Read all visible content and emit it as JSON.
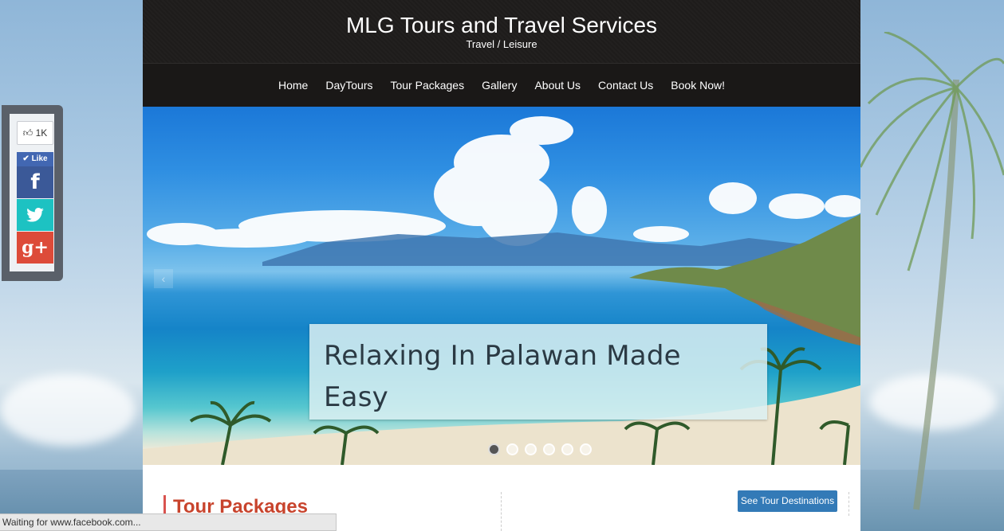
{
  "header": {
    "title": "MLG Tours and Travel Services",
    "tagline": "Travel / Leisure"
  },
  "nav": {
    "items": [
      "Home",
      "DayTours",
      "Tour Packages",
      "Gallery",
      "About Us",
      "Contact Us",
      "Book Now!"
    ]
  },
  "slider": {
    "caption": "Relaxing In Palawan Made Easy",
    "prev_icon": "chevron-left-icon",
    "slide_count": 6,
    "active_slide": 1
  },
  "content": {
    "section_title": "Tour Packages",
    "destinations_button": "See Tour Destinations"
  },
  "social": {
    "like_count": "1K",
    "like_label": "Like",
    "facebook_glyph": "f",
    "googleplus_glyph": "g+",
    "colors": {
      "facebook": "#3b5998",
      "twitter": "#1dc2c2",
      "googleplus": "#dd4b39"
    }
  },
  "status_bar": {
    "text": "Waiting for www.facebook.com..."
  },
  "colors": {
    "header_bg": "#1e1c1b",
    "accent": "#c8442d",
    "button": "#337ab7"
  }
}
